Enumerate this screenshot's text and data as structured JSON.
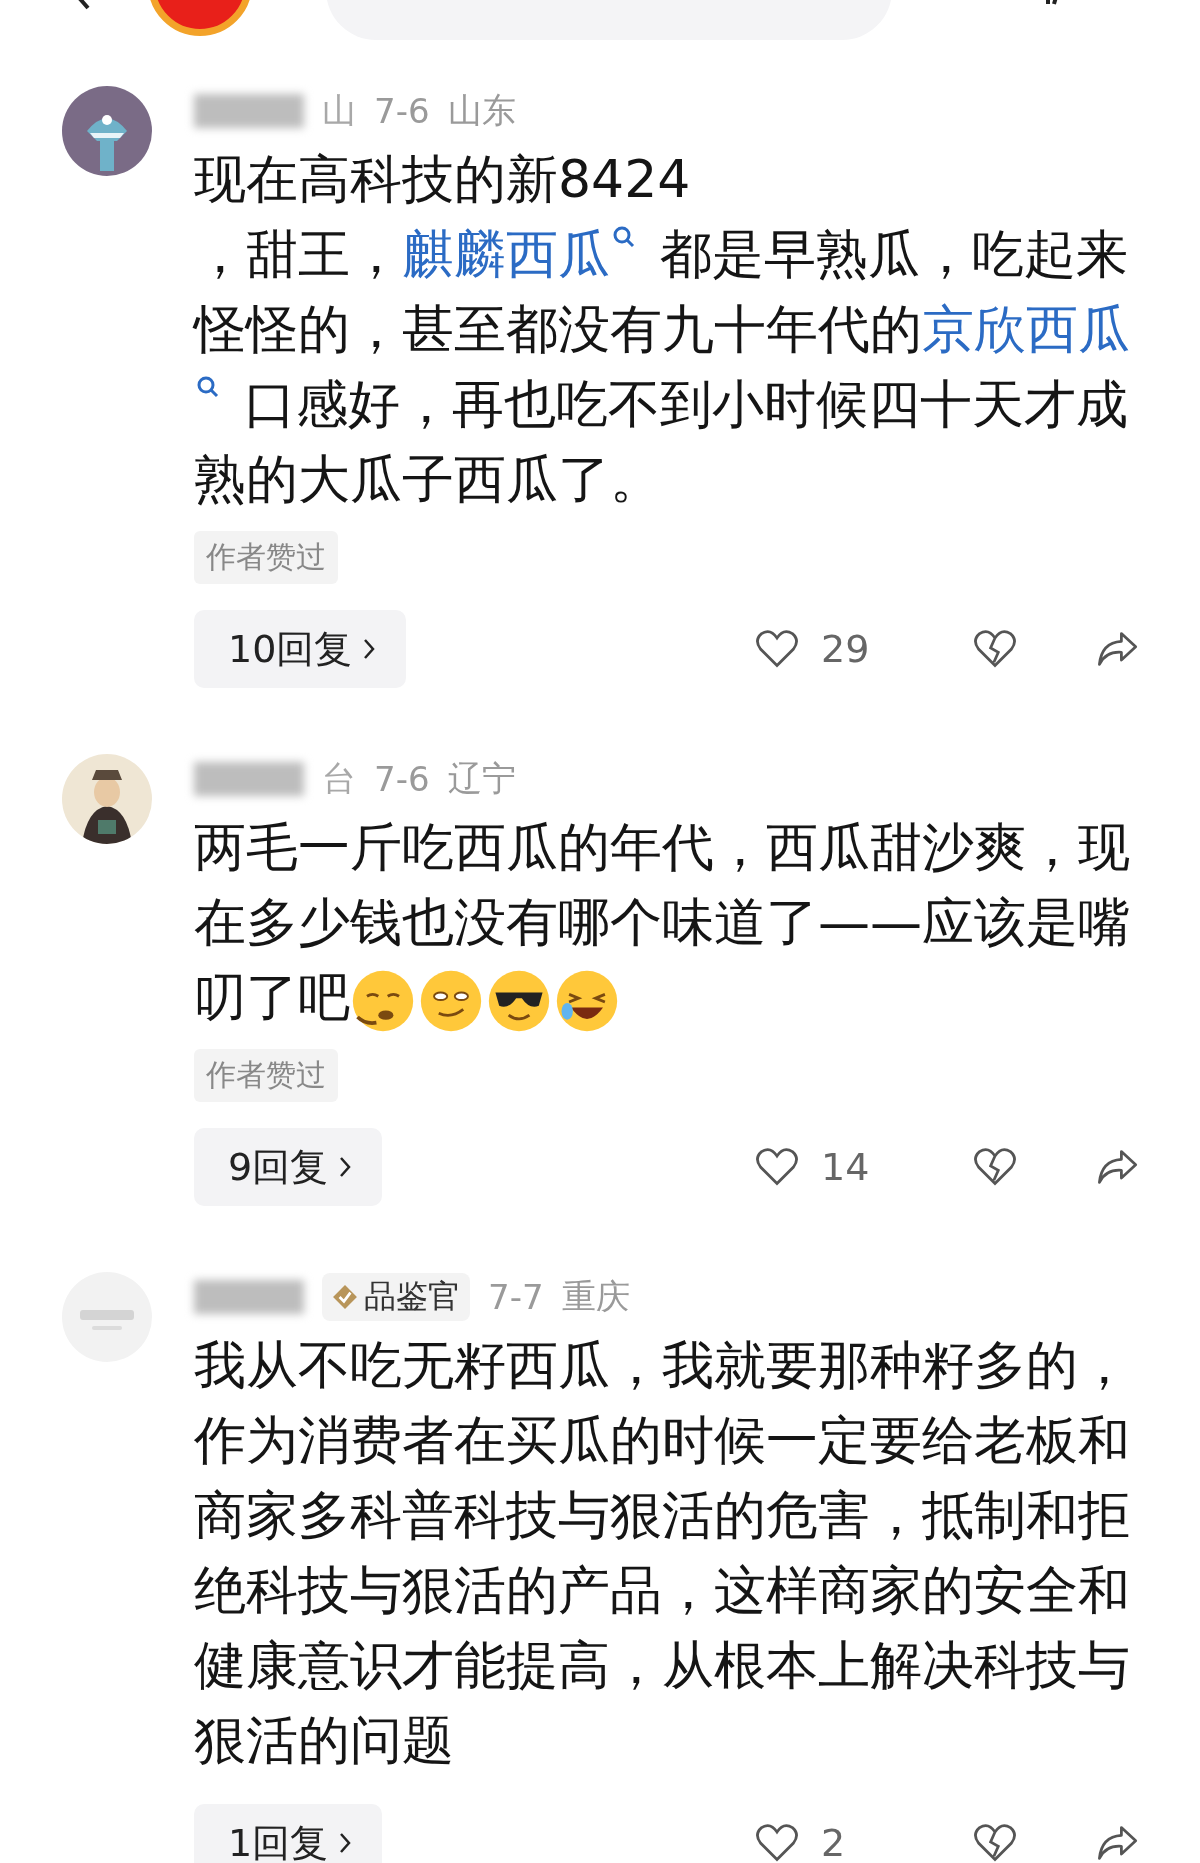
{
  "comments": [
    {
      "name_fragment": "山",
      "date": "7-6",
      "location": "山东",
      "body": [
        {
          "kind": "text",
          "text": "现在高科技的新8424\n，甜王，"
        },
        {
          "kind": "link",
          "text": "麒麟西瓜"
        },
        {
          "kind": "text",
          "text": "都是早熟瓜，吃起来怪怪的，甚至都没有九十年代的"
        },
        {
          "kind": "link",
          "text": "京欣西瓜"
        },
        {
          "kind": "text",
          "text": "口感好，再也吃不到小时候四十天才成熟的大瓜子西瓜了。"
        }
      ],
      "author_liked": "作者赞过",
      "replies": "10回复",
      "likes": "29"
    },
    {
      "name_fragment": "台",
      "date": "7-6",
      "location": "辽宁",
      "body": [
        {
          "kind": "text",
          "text": "两毛一斤吃西瓜的年代，西瓜甜沙爽，现在多少钱也没有哪个味道了——应该是嘴叨了吧"
        },
        {
          "kind": "emoji"
        },
        {
          "kind": "emoji"
        },
        {
          "kind": "emoji"
        },
        {
          "kind": "emoji"
        }
      ],
      "author_liked": "作者赞过",
      "replies": "9回复",
      "likes": "14"
    },
    {
      "badge": "品鉴官",
      "date": "7-7",
      "location": "重庆",
      "body": [
        {
          "kind": "text",
          "text": "我从不吃无籽西瓜，我就要那种籽多的，作为消费者在买瓜的时候一定要给老板和商家多科普科技与狠活的危害，抵制和拒绝科技与狠活的产品，这样商家的安全和健康意识才能提高，从根本上解决科技与狠活的问题"
        }
      ],
      "replies": "1回复",
      "likes": "2"
    }
  ]
}
